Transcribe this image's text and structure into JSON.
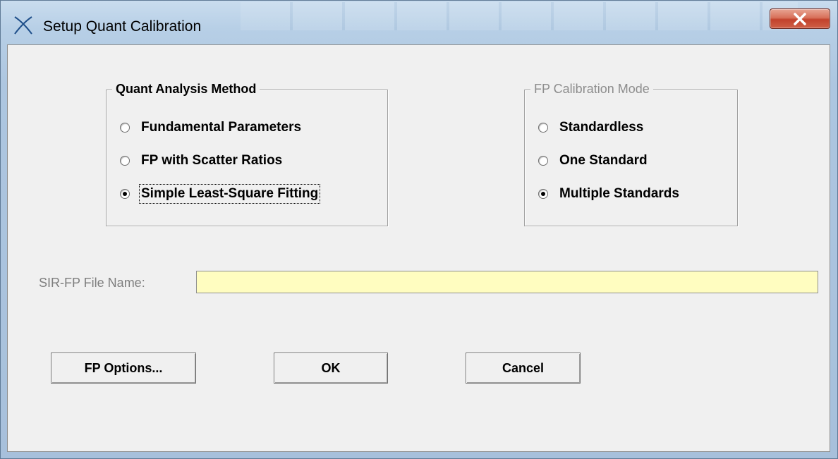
{
  "window": {
    "title": "Setup Quant Calibration",
    "app_icon": "x-cross-icon",
    "close_icon": "close-icon"
  },
  "quant_method": {
    "legend": "Quant Analysis Method",
    "options": [
      {
        "label": "Fundamental Parameters",
        "selected": false
      },
      {
        "label": "FP with Scatter Ratios",
        "selected": false
      },
      {
        "label": "Simple Least-Square Fitting",
        "selected": true
      }
    ]
  },
  "fp_calibration": {
    "legend": "FP Calibration Mode",
    "enabled": false,
    "options": [
      {
        "label": "Standardless",
        "selected": false
      },
      {
        "label": "One Standard",
        "selected": false
      },
      {
        "label": "Multiple Standards",
        "selected": true
      }
    ]
  },
  "file_name": {
    "label": "SIR-FP File Name:",
    "value": "",
    "background": "#fffdc0"
  },
  "buttons": {
    "fp_options": "FP Options...",
    "ok": "OK",
    "cancel": "Cancel"
  },
  "colors": {
    "close_button": "#c94a35",
    "disabled_text": "#8d8d8d"
  }
}
